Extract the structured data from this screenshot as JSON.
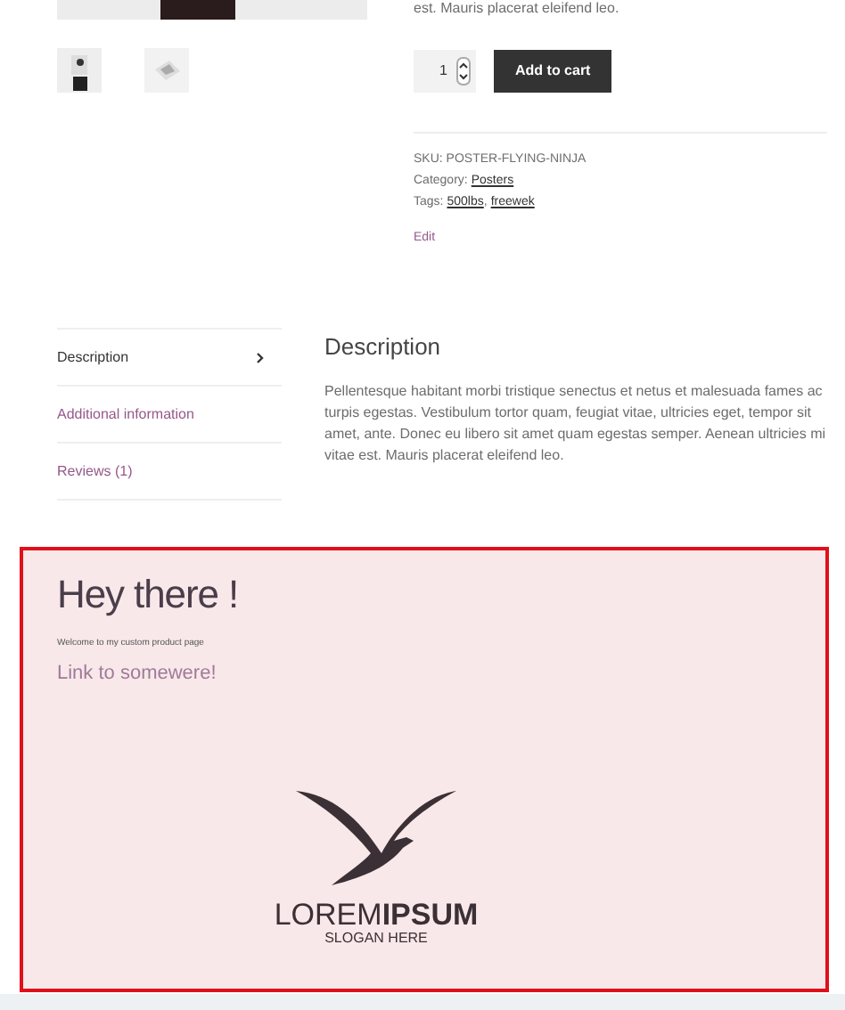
{
  "product": {
    "summary_tail": "est. Mauris placerat eleifend leo.",
    "quantity": "1",
    "add_button": "Add to cart",
    "sku_label": "SKU:",
    "sku": "POSTER-FLYING-NINJA",
    "category_label": "Category:",
    "category": "Posters",
    "tags_label": "Tags:",
    "tags": [
      "500lbs",
      "freewek"
    ],
    "tag_separator": ",",
    "edit": "Edit"
  },
  "tabs": [
    {
      "label": "Description",
      "selected": true
    },
    {
      "label": "Additional information",
      "selected": false
    },
    {
      "label": "Reviews (1)",
      "selected": false
    }
  ],
  "panel": {
    "title": "Description",
    "text": "Pellentesque habitant morbi tristique senectus et netus et malesuada fames ac turpis egestas. Vestibulum tortor quam, feugiat vitae, ultricies eget, tempor sit amet, ante. Donec eu libero sit amet quam egestas semper. Aenean ultricies mi vitae est. Mauris placerat eleifend leo."
  },
  "custom": {
    "heading": "Hey there !",
    "intro": "Welcome to my custom product page",
    "link": "Link to somewere!",
    "logo_name": "LOREM**IPSUM**",
    "logo_slogan": "SLOGAN HERE"
  }
}
